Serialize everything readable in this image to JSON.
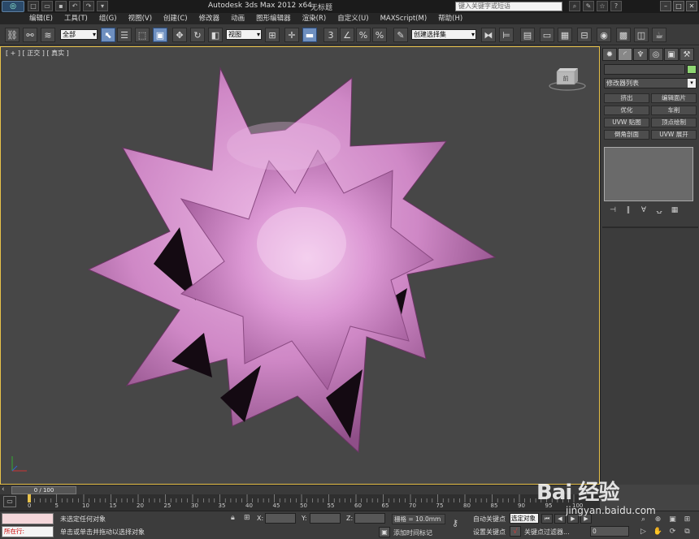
{
  "title_bar": {
    "app_title": "Autodesk 3ds Max  2012 x64",
    "doc_title": "无标题",
    "search_placeholder": "键入关键字或短语",
    "quick_icons": [
      "new-icon",
      "open-icon",
      "save-icon",
      "undo-icon",
      "redo-icon",
      "project-icon"
    ],
    "window_controls": [
      "minimize-icon",
      "maximize-icon",
      "close-icon"
    ]
  },
  "menu": {
    "items": [
      "编辑(E)",
      "工具(T)",
      "组(G)",
      "视图(V)",
      "创建(C)",
      "修改器",
      "动画",
      "图形编辑器",
      "渲染(R)",
      "自定义(U)",
      "MAXScript(M)",
      "帮助(H)"
    ]
  },
  "toolbar": {
    "selection_filter": "全部",
    "ref_coord": "视图",
    "named_selection": "创建选择集",
    "snap_labels": [
      "3",
      "%",
      "%"
    ]
  },
  "viewport": {
    "label": "[ + ] [ 正交 ] [ 真实 ]",
    "viewcube_label": "前",
    "object_color": "#d58fcf",
    "background": "#474747",
    "active_border": "#e8c24a"
  },
  "command_panel": {
    "tabs": [
      "create-icon",
      "modify-icon",
      "hierarchy-icon",
      "motion-icon",
      "display-icon",
      "utilities-icon"
    ],
    "object_color": "#8fd673",
    "modifier_list": "修改器列表",
    "buttons": [
      "挤出",
      "编辑面片",
      "优化",
      "车削",
      "UVW 贴图",
      "顶点绘制",
      "倒角剖面",
      "UVW 展开"
    ],
    "stack_tools": [
      "pin-stack-icon",
      "show-end-result-icon",
      "make-unique-icon",
      "remove-modifier-icon",
      "configure-sets-icon"
    ]
  },
  "timeline": {
    "frame_display": "0 / 100",
    "ticks": [
      "0",
      "5",
      "10",
      "15",
      "20",
      "25",
      "30",
      "35",
      "40",
      "45",
      "50",
      "55",
      "60",
      "65",
      "70",
      "75",
      "80",
      "85",
      "90",
      "95",
      "100"
    ]
  },
  "status": {
    "running": "所在行:",
    "selection": "未选定任何对象",
    "prompt": "单击或单击并拖动以选择对象",
    "x_label": "X:",
    "y_label": "Y:",
    "z_label": "Z:",
    "grid": "栅格 = 10.0mm",
    "add_time_tag": "添加时间标记",
    "auto_key": "自动关键点",
    "set_key": "设置关键点",
    "selection_set": "选定对象",
    "key_filters": "关键点过滤器...",
    "frame_field": "0"
  },
  "watermark": {
    "brand": "Bai 经验",
    "url": "jingyan.baidu.com"
  }
}
